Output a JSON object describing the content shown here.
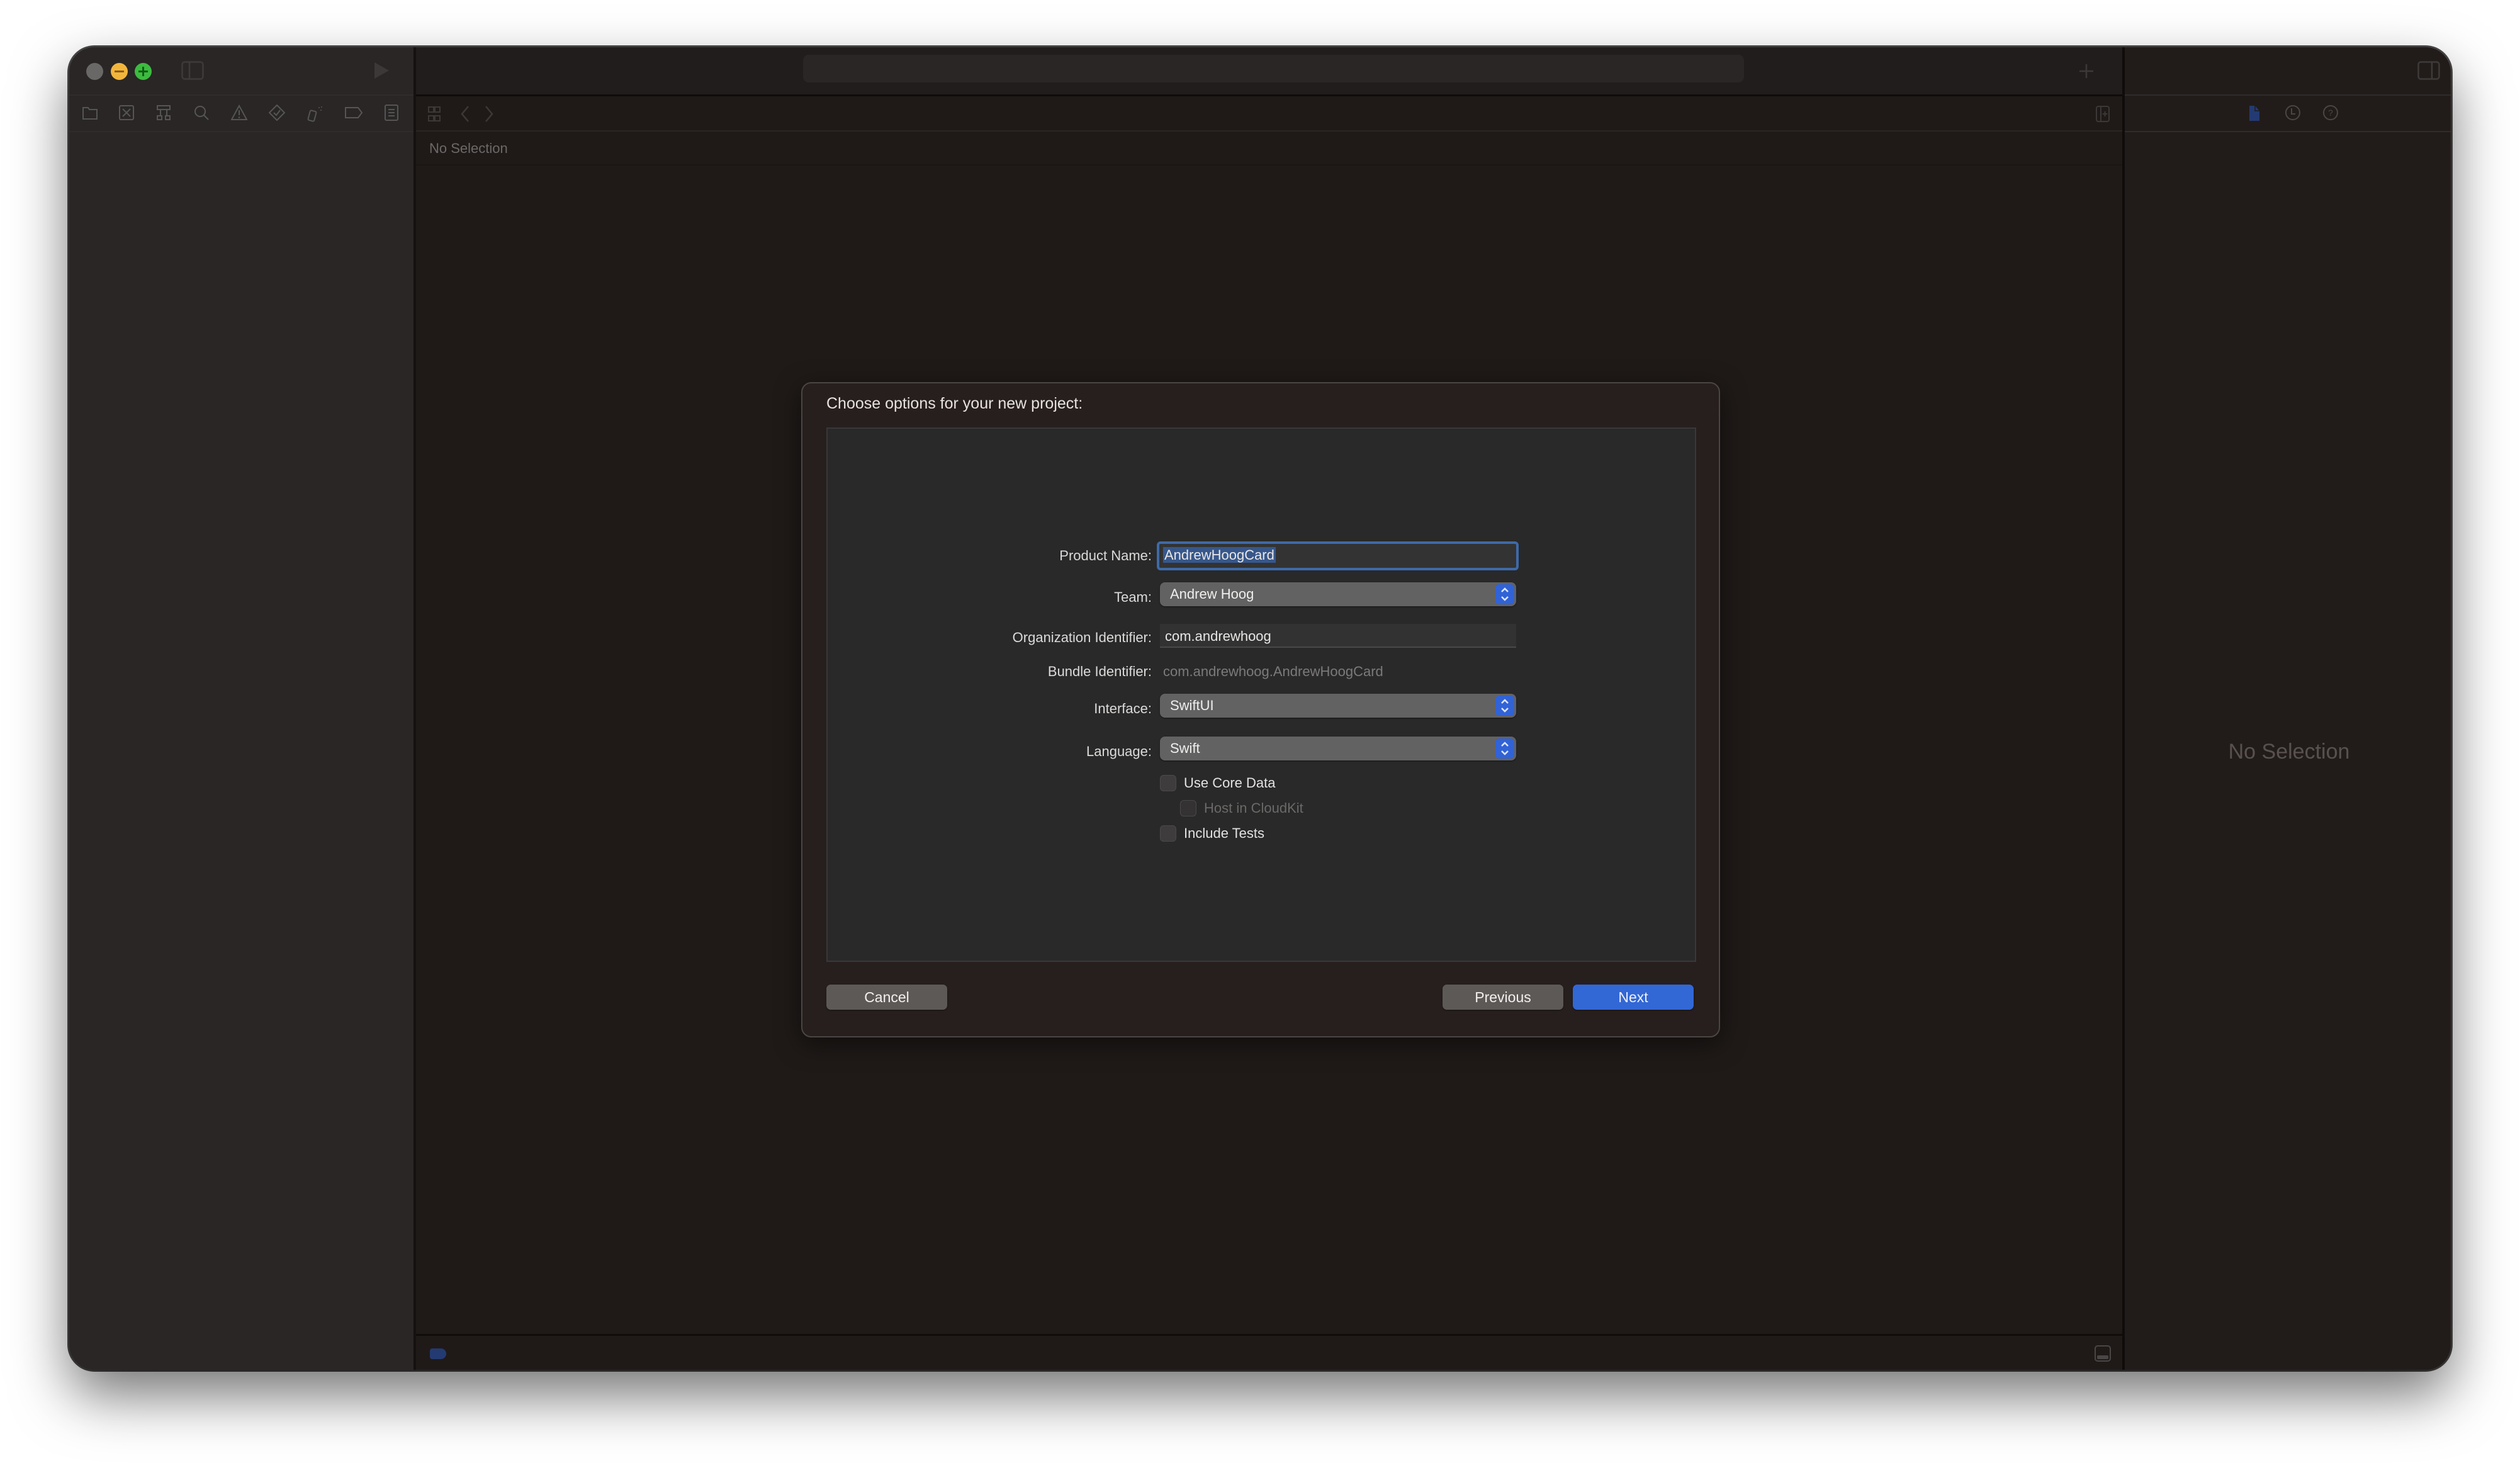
{
  "window": {
    "traffic_lights": [
      "close",
      "minimize",
      "zoom"
    ],
    "title_bar_icons": [
      "sidebar-toggle-icon",
      "run-icon"
    ],
    "navigator_tabs": [
      {
        "icon": "folder-icon",
        "name": "project-navigator"
      },
      {
        "icon": "source-control-icon",
        "name": "source-control-navigator"
      },
      {
        "icon": "symbol-hierarchy-icon",
        "name": "symbol-navigator"
      },
      {
        "icon": "search-icon",
        "name": "find-navigator"
      },
      {
        "icon": "warning-icon",
        "name": "issue-navigator"
      },
      {
        "icon": "test-diamond-icon",
        "name": "test-navigator"
      },
      {
        "icon": "debug-spray-icon",
        "name": "debug-navigator"
      },
      {
        "icon": "breakpoint-tag-icon",
        "name": "breakpoint-navigator"
      },
      {
        "icon": "report-list-icon",
        "name": "report-navigator"
      }
    ]
  },
  "editor": {
    "jump_bar_icons": [
      "related-items-icon",
      "back-icon",
      "forward-icon"
    ],
    "no_selection_label": "No Selection",
    "add_tab_icon": "plus-icon",
    "add_editor_icon": "add-editor-icon"
  },
  "inspector": {
    "tabs": [
      {
        "icon": "file-inspector-icon",
        "active": true
      },
      {
        "icon": "history-icon",
        "active": false
      },
      {
        "icon": "help-icon",
        "active": false
      }
    ],
    "no_selection_label": "No Selection"
  },
  "dialog": {
    "title": "Choose options for your new project:",
    "fields": {
      "product_name": {
        "label": "Product Name:",
        "value": "AndrewHoogCard"
      },
      "team": {
        "label": "Team:",
        "value": "Andrew Hoog"
      },
      "organization_identifier": {
        "label": "Organization Identifier:",
        "value": "com.andrewhoog"
      },
      "bundle_identifier": {
        "label": "Bundle Identifier:",
        "value": "com.andrewhoog.AndrewHoogCard"
      },
      "interface": {
        "label": "Interface:",
        "value": "SwiftUI"
      },
      "language": {
        "label": "Language:",
        "value": "Swift"
      }
    },
    "checkboxes": {
      "use_core_data": {
        "label": "Use Core Data",
        "checked": false,
        "enabled": true
      },
      "host_in_cloudkit": {
        "label": "Host in CloudKit",
        "checked": false,
        "enabled": false
      },
      "include_tests": {
        "label": "Include Tests",
        "checked": false,
        "enabled": true
      }
    },
    "buttons": {
      "cancel": "Cancel",
      "previous": "Previous",
      "next": "Next"
    }
  },
  "colors": {
    "accent": "#3267d6",
    "window_bg": "#201c1a",
    "dialog_bg": "#271f1e"
  }
}
